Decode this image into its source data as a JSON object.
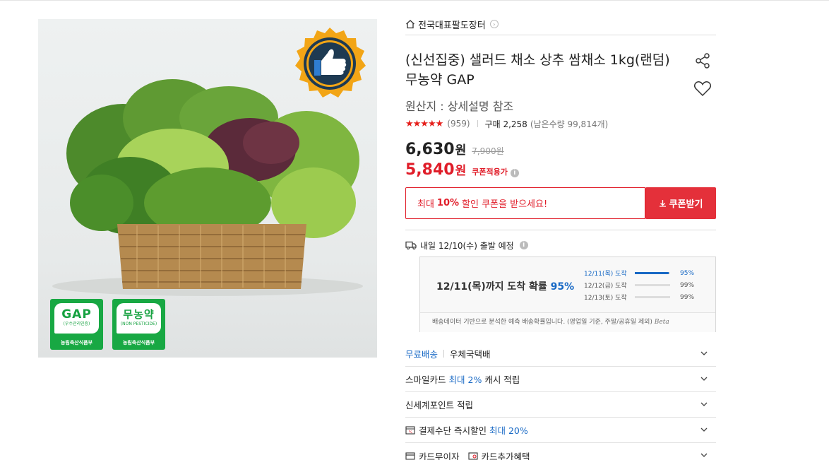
{
  "store": {
    "name": "전국대표팔도장터"
  },
  "product": {
    "title": "(신선집중) 샐러드 채소 상추 쌈채소 1kg(랜덤) 무농약 GAP",
    "origin": "원산지 : 상세설명 참조",
    "stars": "★★★★★",
    "review_count": "(959)",
    "purchase": "구매 2,258",
    "remaining": "(남은수량 99,814개)",
    "rating": 4.5
  },
  "image": {
    "cert_gap_title": "GAP",
    "cert_gap_sub": "(우수관리인증)",
    "cert_gap_foot": "농림축산식품부",
    "cert_np_title": "무농약",
    "cert_np_sub": "(NON PESTICIDE)",
    "cert_np_foot": "농림축산식품부"
  },
  "price": {
    "sale": "6,630",
    "sale_unit": "원",
    "original": "7,900원",
    "coupon": "5,840",
    "coupon_unit": "원",
    "coupon_tag": "쿠폰적용가"
  },
  "coupon": {
    "prefix": "최대",
    "percent": "10%",
    "suffix": "할인 쿠폰을 받으세요!",
    "button": "쿠폰받기"
  },
  "shipping": {
    "departure": "내일 12/10(수) 출발 예정",
    "headline_text": "12/11(목)까지 도착 확률",
    "headline_pct": "95%",
    "rows": [
      {
        "date": "12/11(목) 도착",
        "pct": "95%",
        "value": 0.95
      },
      {
        "date": "12/12(금) 도착",
        "pct": "99%",
        "value": 0.99
      },
      {
        "date": "12/13(토) 도착",
        "pct": "99%",
        "value": 0.99
      }
    ],
    "note": "배송데이터 기반으로 분석한 예측 배송확률입니다. (영업일 기준, 주말/공휴일 제외)",
    "beta": "Beta"
  },
  "accordion": {
    "free_ship": "무료배송",
    "carrier": "우체국택배",
    "smile_prefix": "스마일카드",
    "smile_blue": "최대 2%",
    "smile_suffix": "캐시 적립",
    "ssg_point": "신세계포인트 적립",
    "pay_prefix": "결제수단 즉시할인",
    "pay_blue": "최대 20%",
    "installment": "카드무이자",
    "card_benefit": "카드추가혜택"
  },
  "colors": {
    "accent_red": "#e01d29",
    "accent_blue": "#1869c5",
    "badge_green": "#18a843"
  }
}
